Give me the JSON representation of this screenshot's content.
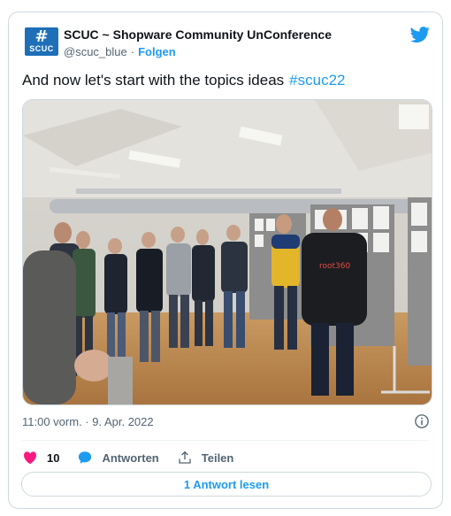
{
  "author": {
    "avatar_text": "SCUC",
    "name": "SCUC ~ Shopware Community UnConference",
    "handle": "@scuc_blue",
    "separator": "·",
    "follow_label": "Folgen"
  },
  "tweet": {
    "text": "And now let's start with the topics ideas",
    "hashtag": "#scuc22"
  },
  "photo": {
    "shirt_text": "root360"
  },
  "meta": {
    "timestamp": "11:00 vorm. · 9. Apr. 2022"
  },
  "actions": {
    "like_count": "10",
    "reply_label": "Antworten",
    "share_label": "Teilen",
    "read_replies_label": "1 Antwort lesen"
  },
  "colors": {
    "accent": "#1d9bf0",
    "like": "#f91880",
    "secondary_text": "#536471",
    "border": "#cfd9de"
  }
}
